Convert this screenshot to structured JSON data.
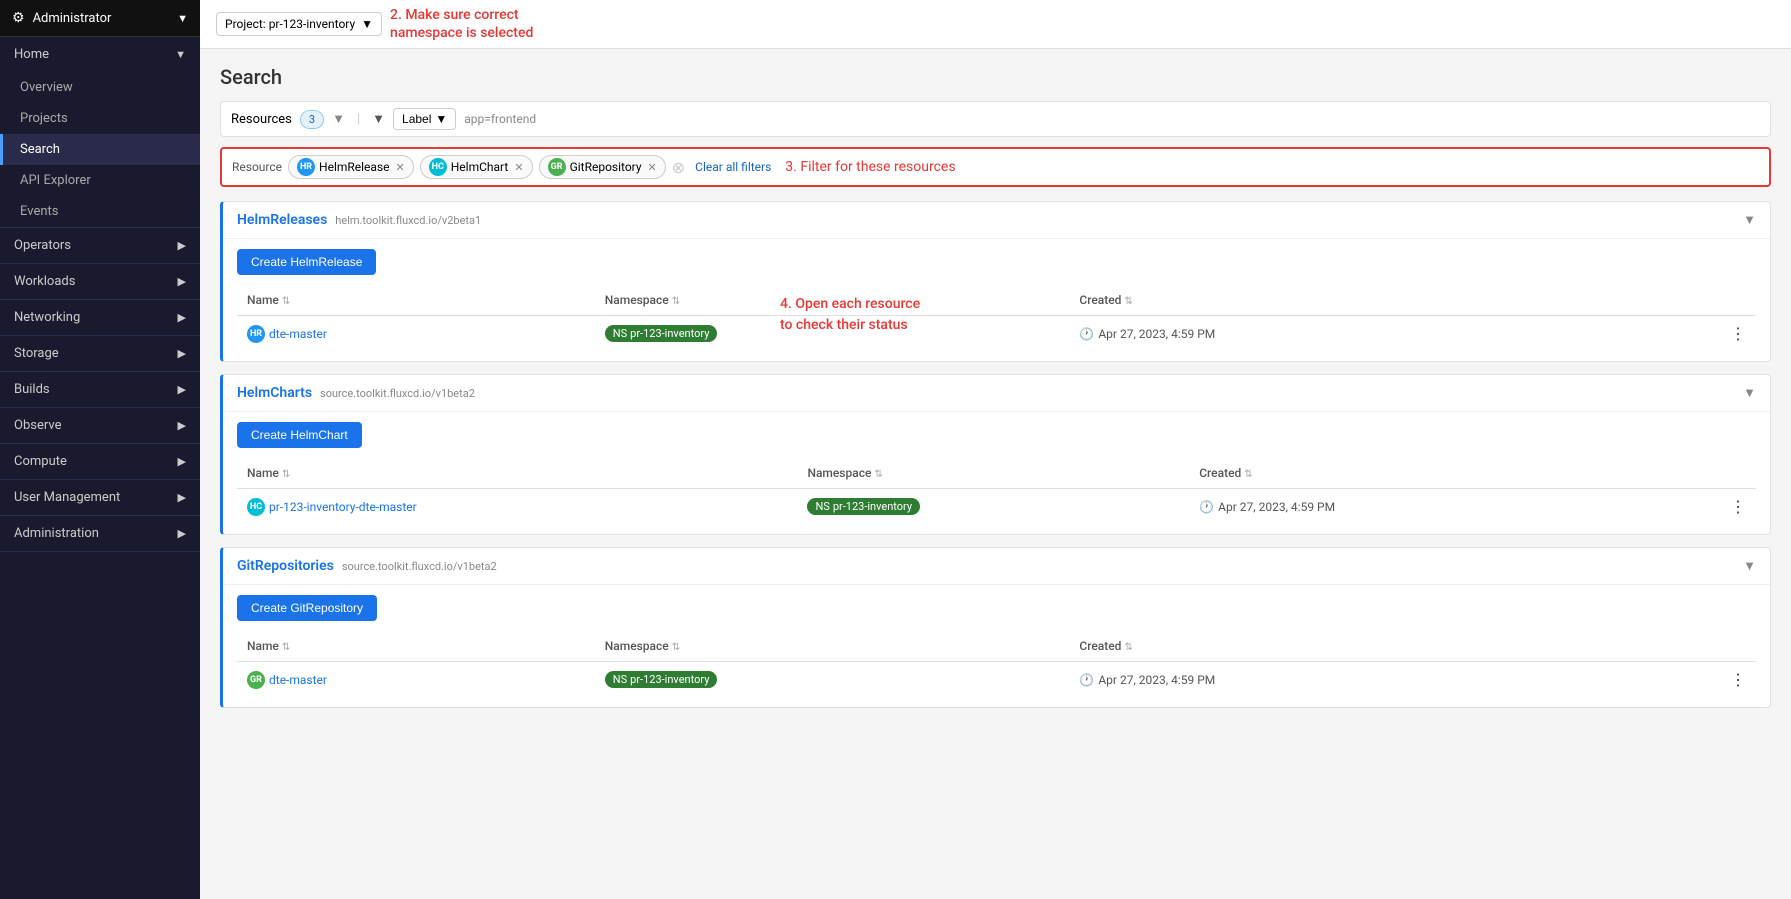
{
  "sidebar": {
    "user": "Administrator",
    "sections": [
      {
        "label": "Home",
        "expanded": true,
        "children": [
          "Overview",
          "Projects",
          "Search",
          "API Explorer",
          "Events"
        ]
      },
      {
        "label": "Operators",
        "expanded": false,
        "children": []
      },
      {
        "label": "Workloads",
        "expanded": false,
        "children": []
      },
      {
        "label": "Networking",
        "expanded": false,
        "children": []
      },
      {
        "label": "Storage",
        "expanded": false,
        "children": []
      },
      {
        "label": "Builds",
        "expanded": false,
        "children": []
      },
      {
        "label": "Observe",
        "expanded": false,
        "children": []
      },
      {
        "label": "Compute",
        "expanded": false,
        "children": []
      },
      {
        "label": "User Management",
        "expanded": false,
        "children": []
      },
      {
        "label": "Administration",
        "expanded": false,
        "children": []
      }
    ]
  },
  "topbar": {
    "project_label": "Project: pr-123-inventory",
    "annotation2_line1": "2.  Make sure correct",
    "annotation2_line2": "namespace is selected"
  },
  "page": {
    "title": "Search"
  },
  "filter_bar": {
    "resources_label": "Resources",
    "resources_count": "3",
    "label_btn": "Label",
    "label_value": "app=frontend"
  },
  "resource_tags": {
    "resource_label": "Resource",
    "tags": [
      {
        "badge": "HR",
        "badge_class": "hr",
        "name": "HelmRelease"
      },
      {
        "badge": "HC",
        "badge_class": "hc",
        "name": "HelmChart"
      },
      {
        "badge": "GR",
        "badge_class": "gr",
        "name": "GitRepository"
      }
    ],
    "clear_label": "Clear all filters",
    "annotation3": "3.  Filter for these resources"
  },
  "sections": [
    {
      "id": "helmreleases",
      "title": "HelmReleases",
      "api": "helm.toolkit.fluxcd.io/v2beta1",
      "create_btn": "Create HelmRelease",
      "columns": [
        "Name",
        "Namespace",
        "Created"
      ],
      "rows": [
        {
          "badge": "HR",
          "badge_class": "hr",
          "name": "dte-master",
          "ns_badge": "NS",
          "ns_badge_class": "green",
          "namespace": "pr-123-inventory",
          "created": "Apr 27, 2023, 4:59 PM"
        }
      ]
    },
    {
      "id": "helmcharts",
      "title": "HelmCharts",
      "api": "source.toolkit.fluxcd.io/v1beta2",
      "create_btn": "Create HelmChart",
      "annotation4_line1": "4.  Open each resource",
      "annotation4_line2": "to check their status",
      "columns": [
        "Name",
        "Namespace",
        "Created"
      ],
      "rows": [
        {
          "badge": "HC",
          "badge_class": "hc",
          "name": "pr-123-inventory-dte-master",
          "ns_badge": "NS",
          "ns_badge_class": "green",
          "namespace": "pr-123-inventory",
          "created": "Apr 27, 2023, 4:59 PM"
        }
      ]
    },
    {
      "id": "gitrepositories",
      "title": "GitRepositories",
      "api": "source.toolkit.fluxcd.io/v1beta2",
      "create_btn": "Create GitRepository",
      "columns": [
        "Name",
        "Namespace",
        "Created"
      ],
      "rows": [
        {
          "badge": "GR",
          "badge_class": "gr",
          "name": "dte-master",
          "ns_badge": "NS",
          "ns_badge_class": "green",
          "namespace": "pr-123-inventory",
          "created": "Apr 27, 2023, 4:59 PM"
        }
      ]
    }
  ]
}
